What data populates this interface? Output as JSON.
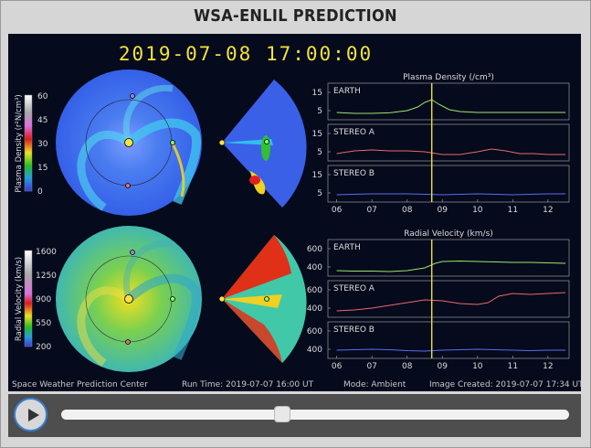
{
  "title": "WSA-ENLIL PREDICTION",
  "timestamp": "2019-07-08  17:00:00",
  "footer": {
    "center": "Space Weather Prediction Center",
    "run_time": "Run Time: 2019-07-07 16:00 UT",
    "mode": "Mode: Ambient",
    "image_created": "Image Created: 2019-07-07 17:34 UT"
  },
  "colorbars": {
    "density": {
      "label": "Plasma Density (r²N/cm³)",
      "ticks": [
        "60",
        "45",
        "30",
        "15",
        "0"
      ]
    },
    "velocity": {
      "label": "Radial Velocity (km/s)",
      "ticks": [
        "1600",
        "1250",
        "900",
        "550",
        "200"
      ]
    }
  },
  "slider": {
    "position": 0.435
  },
  "chart_data": [
    {
      "type": "line",
      "title": "Plasma Density (/cm³)",
      "x_ticks": [
        "06",
        "07",
        "08",
        "09",
        "10",
        "11",
        "12"
      ],
      "marker_x": "08.7",
      "panels": [
        {
          "name": "EARTH",
          "color": "#9be86a",
          "yticks": [
            "15",
            "5"
          ],
          "ylim": [
            0,
            20
          ],
          "x": [
            6.0,
            6.5,
            7.0,
            7.5,
            8.0,
            8.3,
            8.5,
            8.7,
            8.9,
            9.2,
            9.5,
            10.0,
            10.5,
            11.0,
            11.5,
            12.0,
            12.5
          ],
          "y": [
            4.0,
            3.5,
            3.5,
            3.8,
            5.0,
            7.0,
            9.5,
            11.0,
            8.5,
            5.5,
            4.5,
            4.0,
            4.0,
            4.0,
            4.0,
            4.0,
            4.0
          ]
        },
        {
          "name": "STEREO A",
          "color": "#e86a6a",
          "yticks": [
            "15",
            "5"
          ],
          "ylim": [
            0,
            20
          ],
          "x": [
            6.0,
            6.5,
            7.0,
            7.5,
            8.0,
            8.5,
            9.0,
            9.5,
            10.0,
            10.4,
            10.8,
            11.2,
            11.6,
            12.0,
            12.5
          ],
          "y": [
            4.0,
            5.5,
            6.0,
            5.5,
            5.5,
            5.0,
            3.5,
            3.5,
            5.0,
            6.5,
            5.5,
            4.0,
            4.0,
            3.5,
            3.5
          ]
        },
        {
          "name": "STEREO B",
          "color": "#5a6ef0",
          "yticks": [
            "15",
            "5"
          ],
          "ylim": [
            0,
            20
          ],
          "x": [
            6.0,
            7.0,
            8.0,
            9.0,
            10.0,
            11.0,
            12.0,
            12.5
          ],
          "y": [
            4.0,
            4.5,
            4.5,
            4.0,
            4.5,
            4.0,
            4.5,
            4.5
          ]
        }
      ]
    },
    {
      "type": "line",
      "title": "Radial Velocity (km/s)",
      "x_ticks": [
        "06",
        "07",
        "08",
        "09",
        "10",
        "11",
        "12"
      ],
      "marker_x": "08.7",
      "panels": [
        {
          "name": "EARTH",
          "color": "#9be86a",
          "yticks": [
            "600",
            "400"
          ],
          "ylim": [
            300,
            700
          ],
          "x": [
            6.0,
            6.5,
            7.0,
            7.5,
            8.0,
            8.5,
            8.8,
            9.0,
            9.5,
            10.0,
            10.5,
            11.0,
            11.5,
            12.0,
            12.5
          ],
          "y": [
            360,
            355,
            355,
            350,
            360,
            390,
            440,
            460,
            465,
            460,
            455,
            450,
            450,
            445,
            440
          ]
        },
        {
          "name": "STEREO A",
          "color": "#e86a6a",
          "yticks": [
            "600",
            "400"
          ],
          "ylim": [
            300,
            700
          ],
          "x": [
            6.0,
            6.5,
            7.0,
            7.5,
            8.0,
            8.5,
            9.0,
            9.5,
            10.0,
            10.3,
            10.6,
            11.0,
            11.5,
            12.0,
            12.5
          ],
          "y": [
            370,
            380,
            400,
            430,
            460,
            490,
            480,
            450,
            440,
            460,
            530,
            560,
            550,
            560,
            570
          ]
        },
        {
          "name": "STEREO B",
          "color": "#5a6ef0",
          "yticks": [
            "600",
            "400"
          ],
          "ylim": [
            300,
            700
          ],
          "x": [
            6.0,
            6.5,
            7.0,
            7.5,
            8.0,
            8.5,
            9.0,
            9.5,
            10.0,
            10.5,
            11.0,
            11.5,
            12.0,
            12.5
          ],
          "y": [
            390,
            395,
            400,
            395,
            385,
            380,
            390,
            395,
            400,
            395,
            390,
            385,
            390,
            390
          ]
        }
      ]
    }
  ]
}
